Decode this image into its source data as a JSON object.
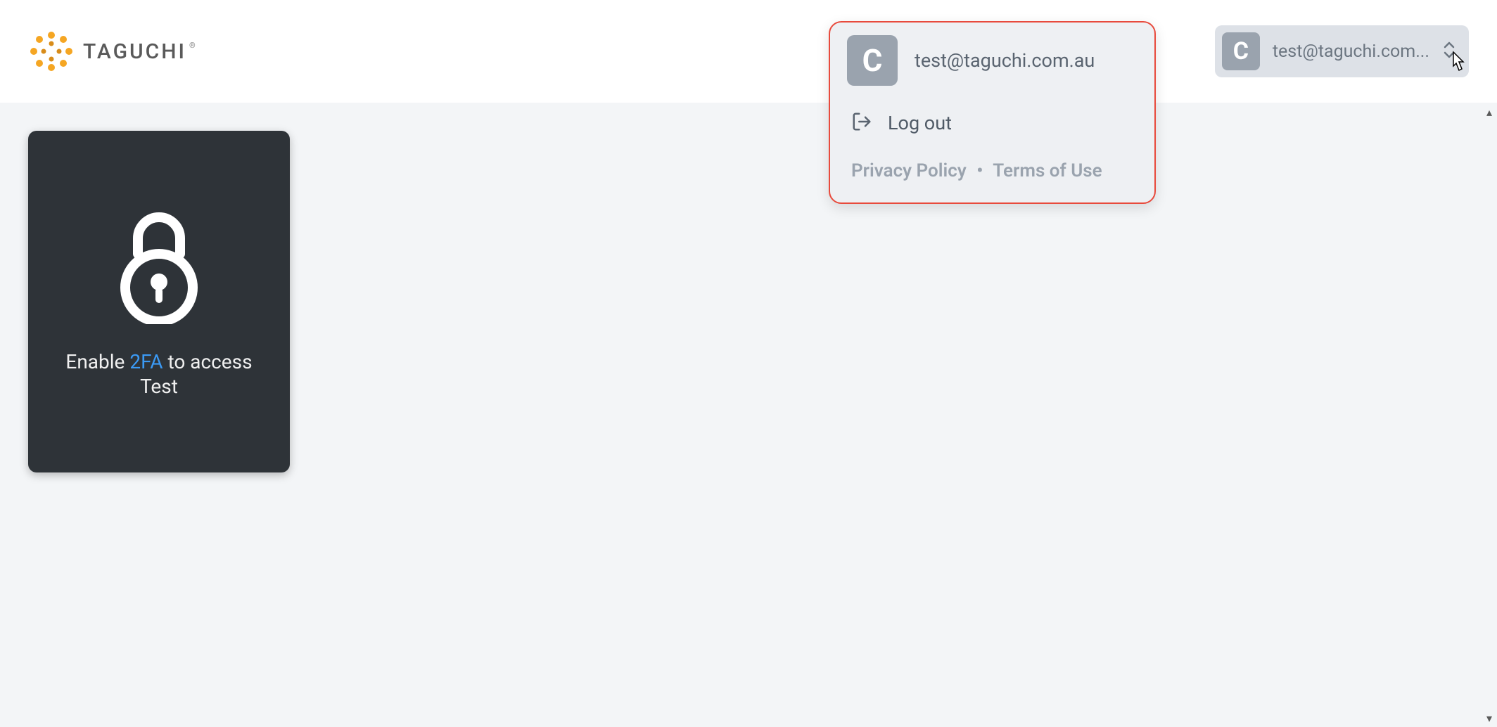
{
  "brand": {
    "name": "TAGUCHI",
    "registered": "®"
  },
  "header": {
    "user_chip": {
      "avatar_letter": "C",
      "email_truncated": "test@taguchi.com..."
    }
  },
  "user_dropdown": {
    "avatar_letter": "C",
    "email": "test@taguchi.com.au",
    "logout_label": "Log out",
    "footer": {
      "privacy": "Privacy Policy",
      "separator": "•",
      "terms": "Terms of Use"
    }
  },
  "card": {
    "prefix": "Enable ",
    "link": "2FA",
    "middle": " to access",
    "org": "Test"
  }
}
